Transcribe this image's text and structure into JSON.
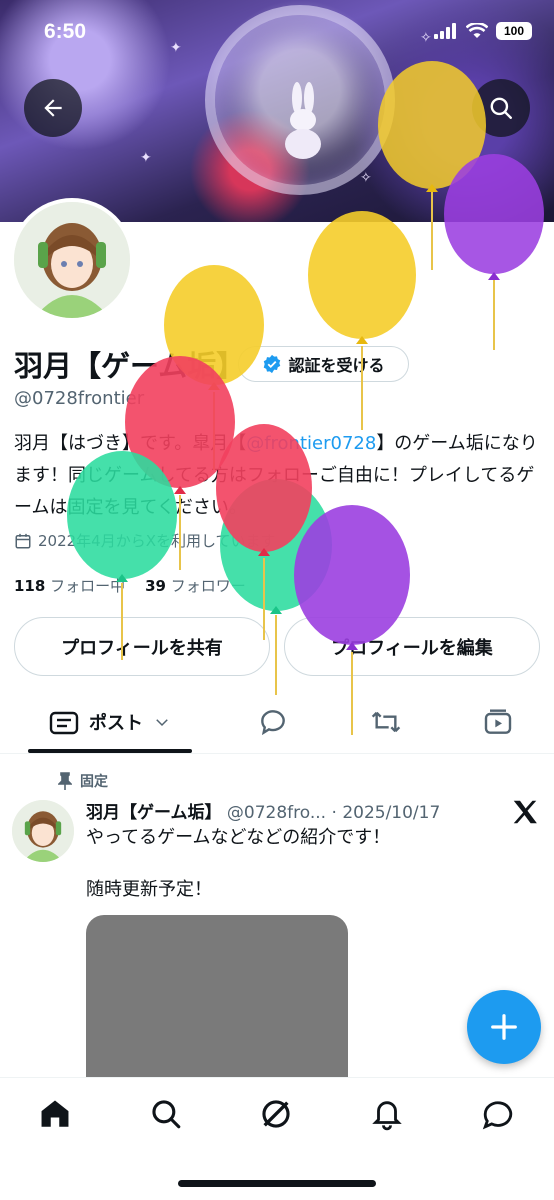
{
  "status_bar": {
    "time": "6:50",
    "battery": "100"
  },
  "profile": {
    "name": "羽月【ゲーム垢】",
    "verify_label": "認証を受ける",
    "handle": "@0728frontier",
    "bio_part1": "羽月【はづき】です。皐月【",
    "bio_link": "@frontier0728",
    "bio_part2": "】のゲーム垢になります！同じゲームしてる方はフォローご自由に！プレイしてるゲームは固定を見てください。",
    "joined": "2022年4月からXを利用しています",
    "following_count": "118",
    "following_label": "フォロー中",
    "followers_count": "39",
    "followers_label": "フォロワー"
  },
  "actions": {
    "share": "プロフィールを共有",
    "edit": "プロフィールを編集"
  },
  "tabs": {
    "posts": "ポスト"
  },
  "post": {
    "pinned_label": "固定",
    "author": "羽月【ゲーム垢】",
    "handle": "@0728fro...",
    "separator": "·",
    "date": "2025/10/17",
    "text": "やってるゲームなどなどの紹介です！\n\n随時更新予定！"
  },
  "icons": {
    "back": "arrow-left-icon",
    "search": "search-icon",
    "verified": "verified-badge-icon",
    "calendar": "calendar-icon",
    "pin": "pin-icon",
    "x": "x-logo-icon",
    "compose": "plus-icon",
    "nav": [
      "home-icon",
      "search-icon",
      "grok-icon",
      "bell-icon",
      "messages-icon"
    ]
  },
  "colors": {
    "accent": "#1d9bf0",
    "text": "#0f1419",
    "muted": "#536471",
    "border": "#cfd9de"
  }
}
